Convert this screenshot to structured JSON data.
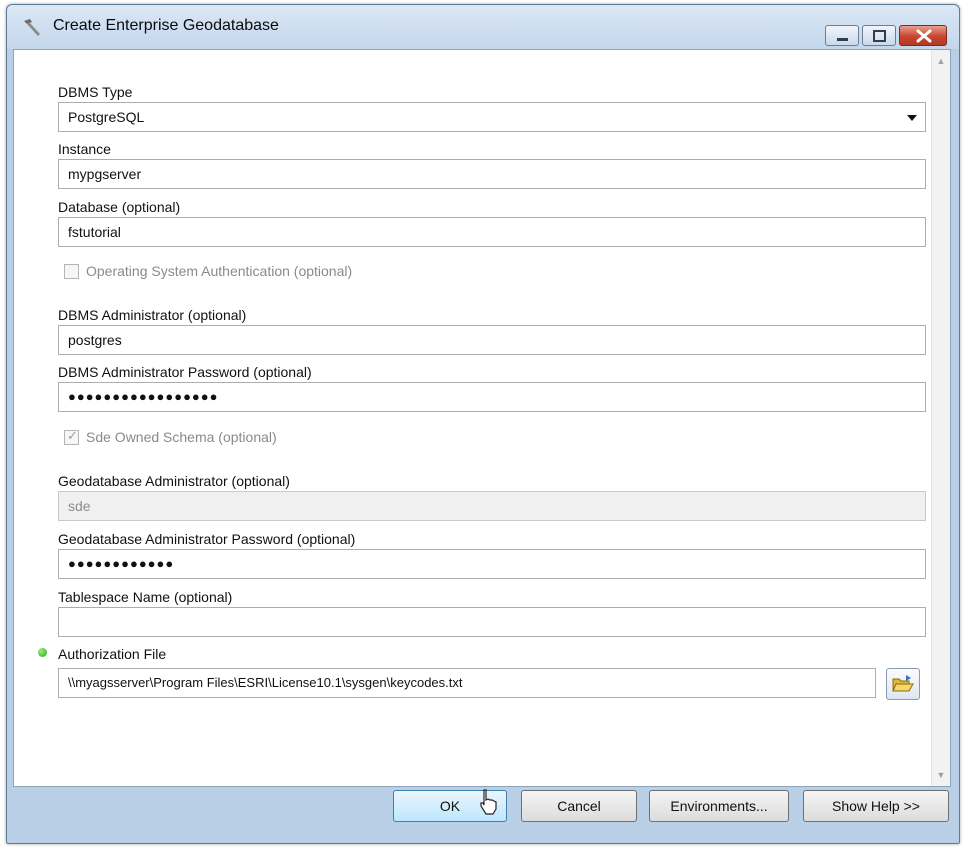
{
  "window": {
    "title": "Create Enterprise Geodatabase",
    "icon": "hammer-icon"
  },
  "fields": {
    "dbms_type": {
      "label": "DBMS Type",
      "value": "PostgreSQL"
    },
    "instance": {
      "label": "Instance",
      "value": "mypgserver"
    },
    "database": {
      "label": "Database (optional)",
      "value": "fstutorial"
    },
    "os_auth": {
      "label": "Operating System Authentication (optional)",
      "checked": false
    },
    "dbms_admin": {
      "label": "DBMS Administrator (optional)",
      "value": "postgres"
    },
    "dbms_admin_password": {
      "label": "DBMS Administrator Password (optional)",
      "value": "●●●●●●●●●●●●●●●●●"
    },
    "sde_schema": {
      "label": "Sde Owned Schema (optional)",
      "checked": true
    },
    "gdb_admin": {
      "label": "Geodatabase Administrator (optional)",
      "value": "sde"
    },
    "gdb_admin_password": {
      "label": "Geodatabase Administrator Password (optional)",
      "value": "●●●●●●●●●●●●"
    },
    "tablespace": {
      "label": "Tablespace Name (optional)",
      "value": ""
    },
    "auth_file": {
      "label": "Authorization File",
      "value": "\\\\myagsserver\\Program Files\\ESRI\\License10.1\\sysgen\\keycodes.txt"
    }
  },
  "buttons": {
    "ok": "OK",
    "cancel": "Cancel",
    "environments": "Environments...",
    "show_help": "Show Help >>"
  },
  "colors": {
    "title_bar": "#c3d6eb",
    "close_button": "#c7452e",
    "required_dot": "#22a31a"
  }
}
